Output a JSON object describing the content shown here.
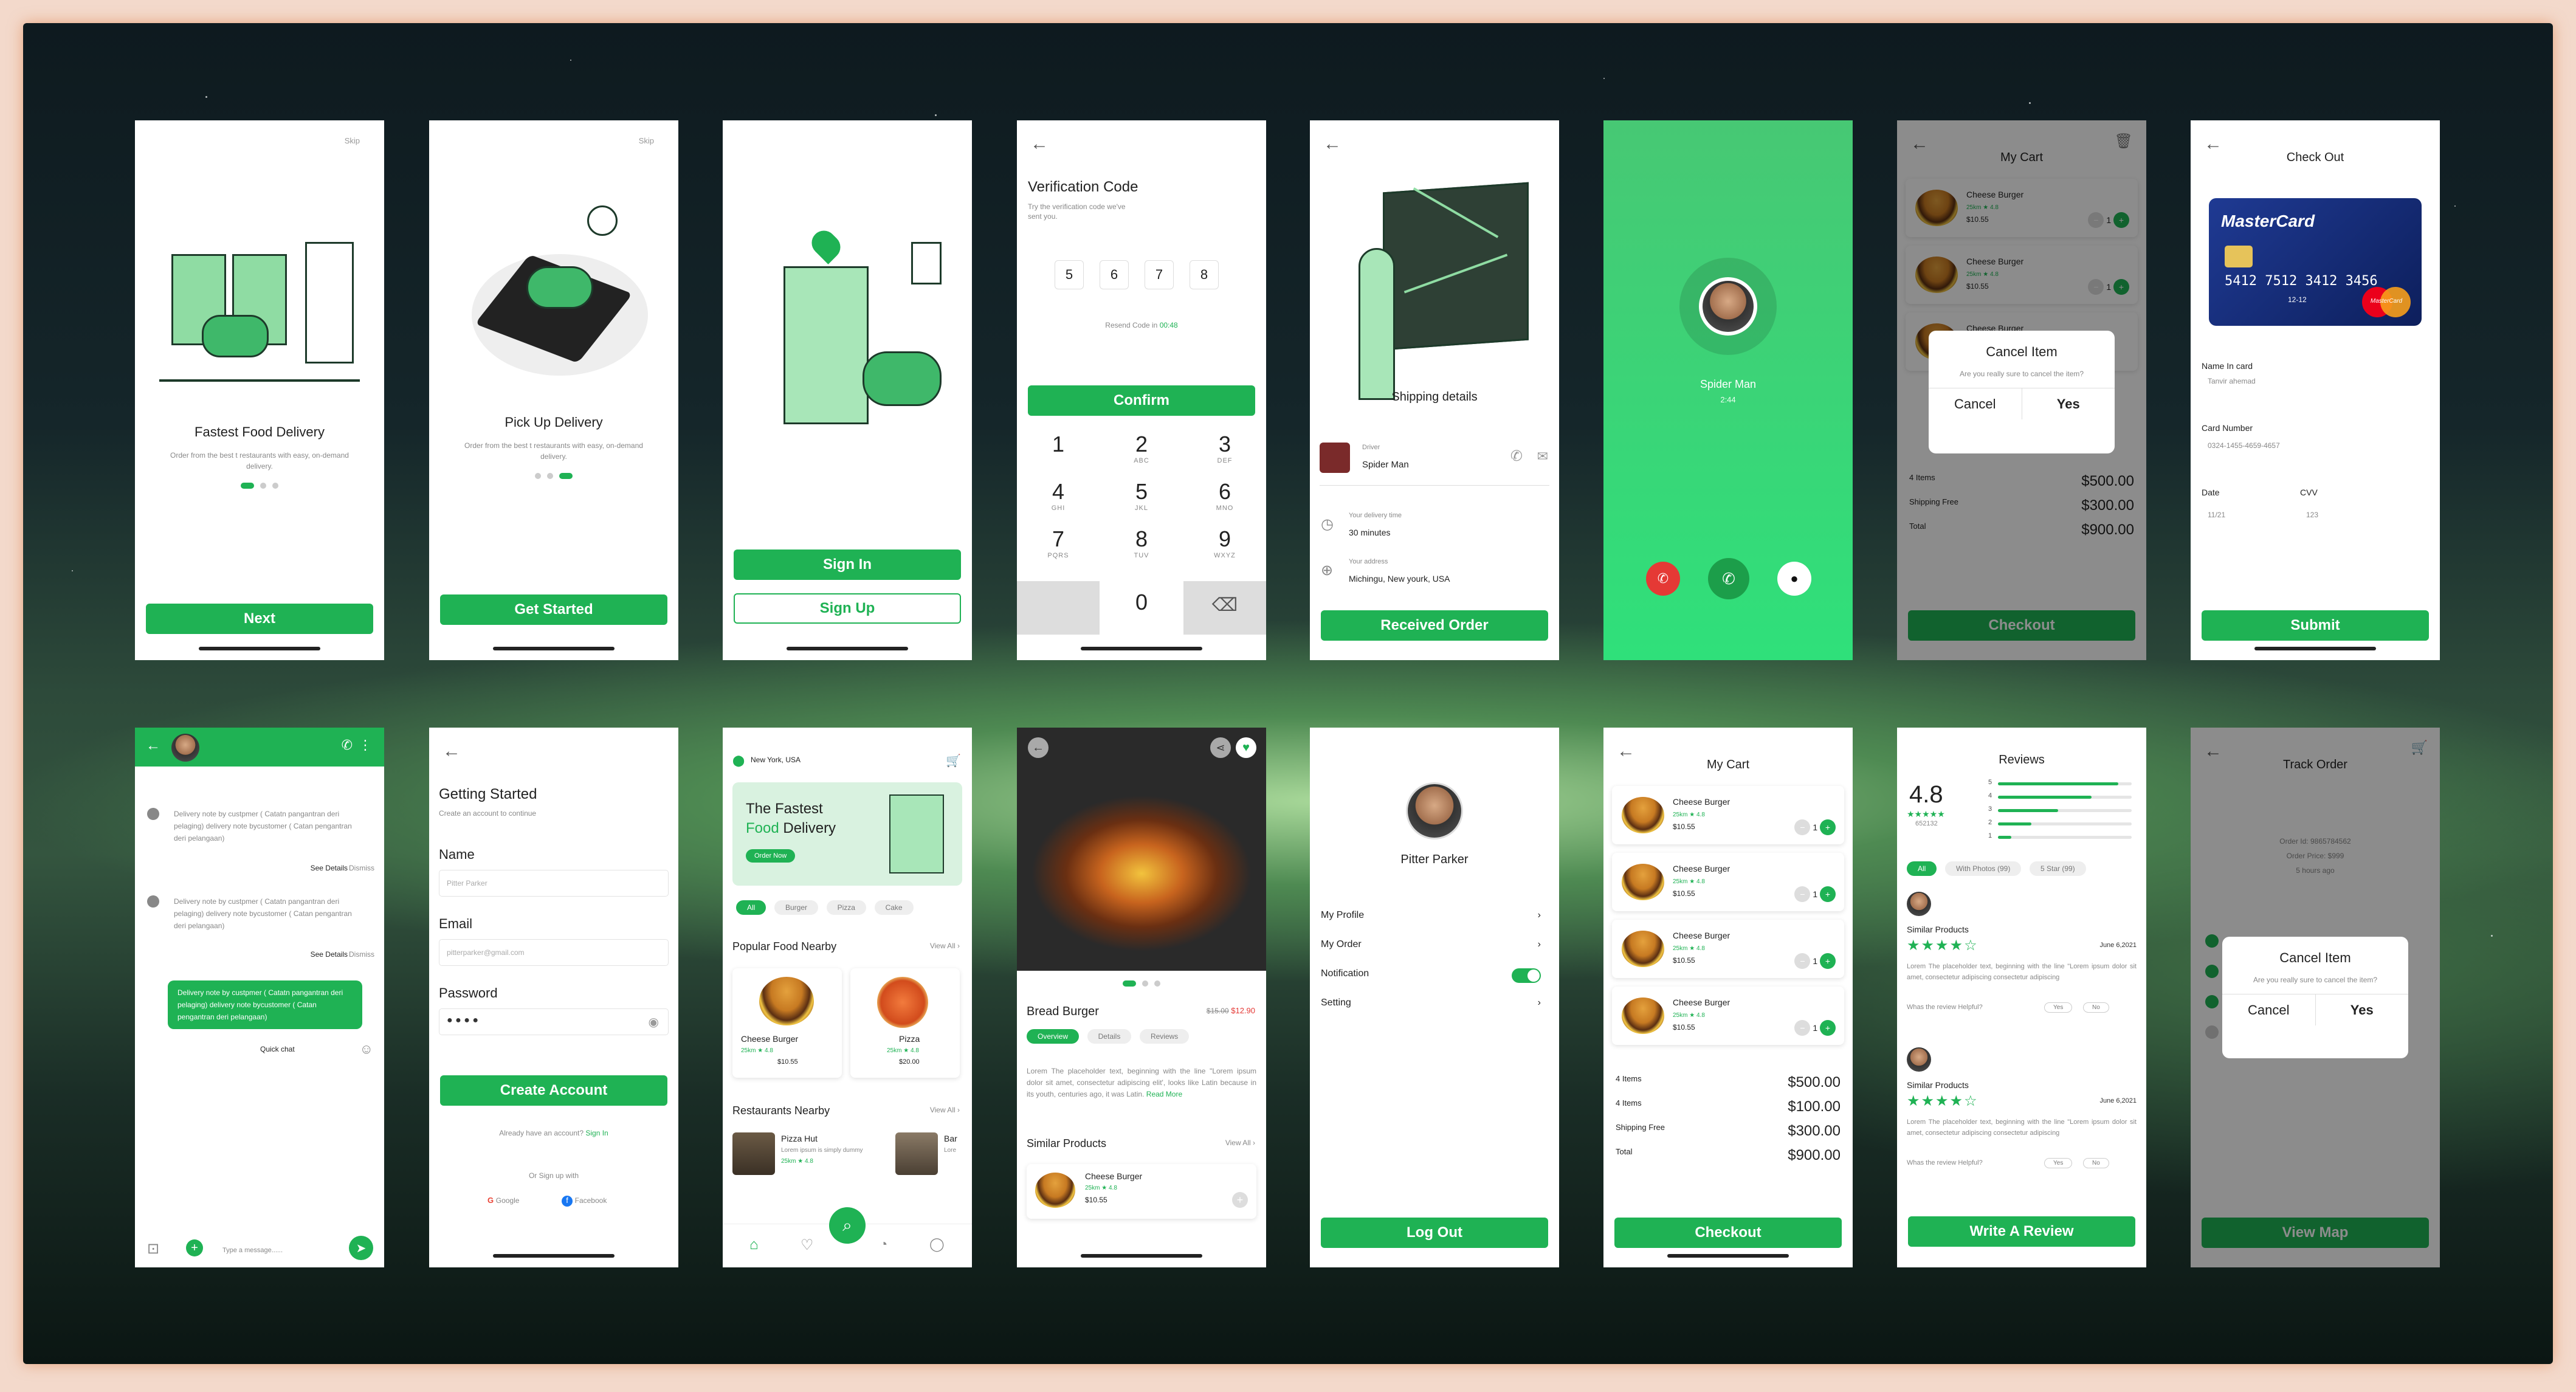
{
  "colors": {
    "accent": "#1fb254",
    "dark": "#222222",
    "muted": "#888888"
  },
  "onboard1": {
    "skip": "Skip",
    "title": "Fastest Food Delivery",
    "subtitle": "Order from the best t restaurants with easy, on-demand delivery.",
    "button": "Next"
  },
  "onboard2": {
    "skip": "Skip",
    "title": "Pick Up Delivery",
    "subtitle": "Order from the best t restaurants with easy, on-demand delivery.",
    "button": "Get Started"
  },
  "signin": {
    "signin": "Sign In",
    "signup": "Sign Up"
  },
  "verify": {
    "title": "Verification Code",
    "subtitle": "Try the verification code we've sent you.",
    "digits": [
      "5",
      "6",
      "7",
      "8"
    ],
    "resend": "Resend Code in",
    "timer": "00:48",
    "confirm": "Confirm",
    "keys": [
      {
        "n": "1",
        "l": ""
      },
      {
        "n": "2",
        "l": "ABC"
      },
      {
        "n": "3",
        "l": "DEF"
      },
      {
        "n": "4",
        "l": "GHI"
      },
      {
        "n": "5",
        "l": "JKL"
      },
      {
        "n": "6",
        "l": "MNO"
      },
      {
        "n": "7",
        "l": "PQRS"
      },
      {
        "n": "8",
        "l": "TUV"
      },
      {
        "n": "9",
        "l": "WXYZ"
      }
    ],
    "zero": "0"
  },
  "shipping": {
    "title": "Shipping details",
    "driver_label": "Driver",
    "driver_name": "Spider Man",
    "time_label": "Your delivery time",
    "time_value": "30 minutes",
    "address_label": "Your address",
    "address_value": "Michingu, New yourk, USA",
    "button": "Received Order"
  },
  "call": {
    "name": "Spider Man",
    "duration": "2:44"
  },
  "cart_modal": {
    "title": "My Cart",
    "item": "Cheese Burger",
    "meta": "25km ★ 4.8",
    "price": "$10.55",
    "qty": "1",
    "items_label": "4 Items",
    "items_value": "$500.00",
    "shipping_label": "Shipping Free",
    "shipping_value": "$300.00",
    "total_label": "Total",
    "total_value": "$900.00",
    "button": "Checkout",
    "modal_title": "Cancel Item",
    "modal_text": "Are you really sure to cancel the item?",
    "cancel": "Cancel",
    "yes": "Yes"
  },
  "checkout": {
    "title": "Check Out",
    "card_brand": "MasterCard",
    "card_digits": "5412  7512  3412  3456",
    "card_small": "12-12",
    "card_logo": "MasterCard",
    "name_label": "Name In card",
    "name_value": "Tanvir ahemad",
    "number_label": "Card Number",
    "number_value": "0324-1455-4659-4657",
    "date_label": "Date",
    "date_value": "11/21",
    "cvv_label": "CVV",
    "cvv_value": "123",
    "button": "Submit"
  },
  "chat": {
    "msg": "Delivery note by custpmer ( Catatn pangantran deri pelaging) delivery note bycustomer ( Catan pengantran deri pelangaan)",
    "see": "See Details",
    "dismiss": "Dismiss",
    "bubble": "Delivery note by custpmer ( Catatn pangantran deri pelaging) delivery note bycustomer ( Catan pengantran deri pelangaan)",
    "quick": "Quick chat",
    "placeholder": "Type a message......"
  },
  "getstarted": {
    "title": "Getting Started",
    "subtitle": "Create an account to continue",
    "name_label": "Name",
    "name_value": "Pitter Parker",
    "email_label": "Email",
    "email_value": "pitterparker@gmail.com",
    "password_label": "Password",
    "password_value": "● ● ● ●",
    "button": "Create Account",
    "have": "Already have an account?",
    "signin": "Sign In",
    "or": "Or Sign up with",
    "google": "Google",
    "facebook": "Facebook"
  },
  "home": {
    "location": "New York, USA",
    "banner_l1": "The Fastest",
    "banner_l2a": "Food",
    "banner_l2b": " Delivery",
    "banner_btn": "Order Now",
    "chips": [
      "All",
      "Burger",
      "Pizza",
      "Cake"
    ],
    "popular": "Popular Food Nearby",
    "view_all": "View All",
    "food1": "Cheese Burger",
    "food1_meta": "25km ★ 4.8",
    "food1_price": "$10.55",
    "food2": "Pizza",
    "food2_meta": "25km ★ 4.8",
    "food2_price": "$20.00",
    "restaurants": "Restaurants Nearby",
    "rest1": "Pizza Hut",
    "rest1_desc": "Lorem ipsum is simply dummy",
    "rest1_meta": "25km ★ 4.8",
    "rest2": "Bar",
    "rest2_desc": "Lore"
  },
  "product": {
    "name": "Bread Burger",
    "old_price": "$15.00",
    "price": "$12.90",
    "tabs": [
      "Overview",
      "Details",
      "Reviews"
    ],
    "desc": "Lorem The placeholder text, beginning with the line \"Lorem ipsum dolor sit amet, consectetur adipiscing elit', looks like Latin because in its youth, centuries ago, it was Latin.",
    "read_more": "Read More",
    "similar": "Similar Products",
    "view_all": "View All",
    "sim_name": "Cheese Burger",
    "sim_meta": "25km ★ 4.8",
    "sim_price": "$10.55"
  },
  "profile": {
    "name": "Pitter Parker",
    "items": [
      "My Profile",
      "My Order",
      "Notification",
      "Setting"
    ],
    "button": "Log Out"
  },
  "cart": {
    "title": "My Cart",
    "item": "Cheese Burger",
    "meta": "25km ★ 4.8",
    "price": "$10.55",
    "qty": "1",
    "rows": [
      {
        "l": "4 Items",
        "v": "$500.00"
      },
      {
        "l": "4 Items",
        "v": "$100.00"
      },
      {
        "l": "Shipping Free",
        "v": "$300.00"
      },
      {
        "l": "Total",
        "v": "$900.00"
      }
    ],
    "button": "Checkout"
  },
  "reviews": {
    "title": "Reviews",
    "score": "4.8",
    "count": "652132",
    "stars": "★★★★★",
    "bars": [
      {
        "n": "5",
        "p": 0.9
      },
      {
        "n": "4",
        "p": 0.7
      },
      {
        "n": "3",
        "p": 0.45
      },
      {
        "n": "2",
        "p": 0.25
      },
      {
        "n": "1",
        "p": 0.1
      }
    ],
    "filters": [
      "All",
      "With Photos (99)",
      "5 Star (99)"
    ],
    "r_title": "Similar Products",
    "r_stars": "★★★★☆",
    "r_date": "June 6,2021",
    "r_text": "Lorem The placeholder text, beginning with the line \"Lorem ipsum dolor sit amet, consectetur adipiscing consectetur adipiscing",
    "helpful": "Whas the review Helpful?",
    "yes": "Yes",
    "no": "No",
    "button": "Write A Review"
  },
  "track": {
    "title": "Track Order",
    "order_id": "Order Id: 9865784562",
    "order_price": "Order Price: $999",
    "time": "5 hours ago",
    "modal_title": "Cancel Item",
    "modal_text": "Are you really sure to cancel the item?",
    "cancel": "Cancel",
    "yes": "Yes",
    "button": "View Map"
  }
}
